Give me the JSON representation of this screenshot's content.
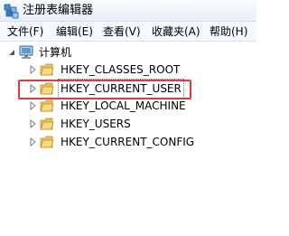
{
  "window": {
    "title": "注册表编辑器",
    "accent": "#e23a3a"
  },
  "menu": {
    "items": [
      {
        "label": "文件(F)"
      },
      {
        "label": "编辑(E)"
      },
      {
        "label": "查看(V)"
      },
      {
        "label": "收藏夹(A)"
      },
      {
        "label": "帮助(H)"
      }
    ]
  },
  "tree": {
    "root": {
      "label": "计算机",
      "icon": "computer-icon",
      "expanded": true
    },
    "children": [
      {
        "label": "HKEY_CLASSES_ROOT",
        "icon": "folder-icon",
        "selected": false
      },
      {
        "label": "HKEY_CURRENT_USER",
        "icon": "folder-icon",
        "selected": true
      },
      {
        "label": "HKEY_LOCAL_MACHINE",
        "icon": "folder-icon",
        "selected": false
      },
      {
        "label": "HKEY_USERS",
        "icon": "folder-icon",
        "selected": false
      },
      {
        "label": "HKEY_CURRENT_CONFIG",
        "icon": "folder-icon",
        "selected": false
      }
    ]
  }
}
